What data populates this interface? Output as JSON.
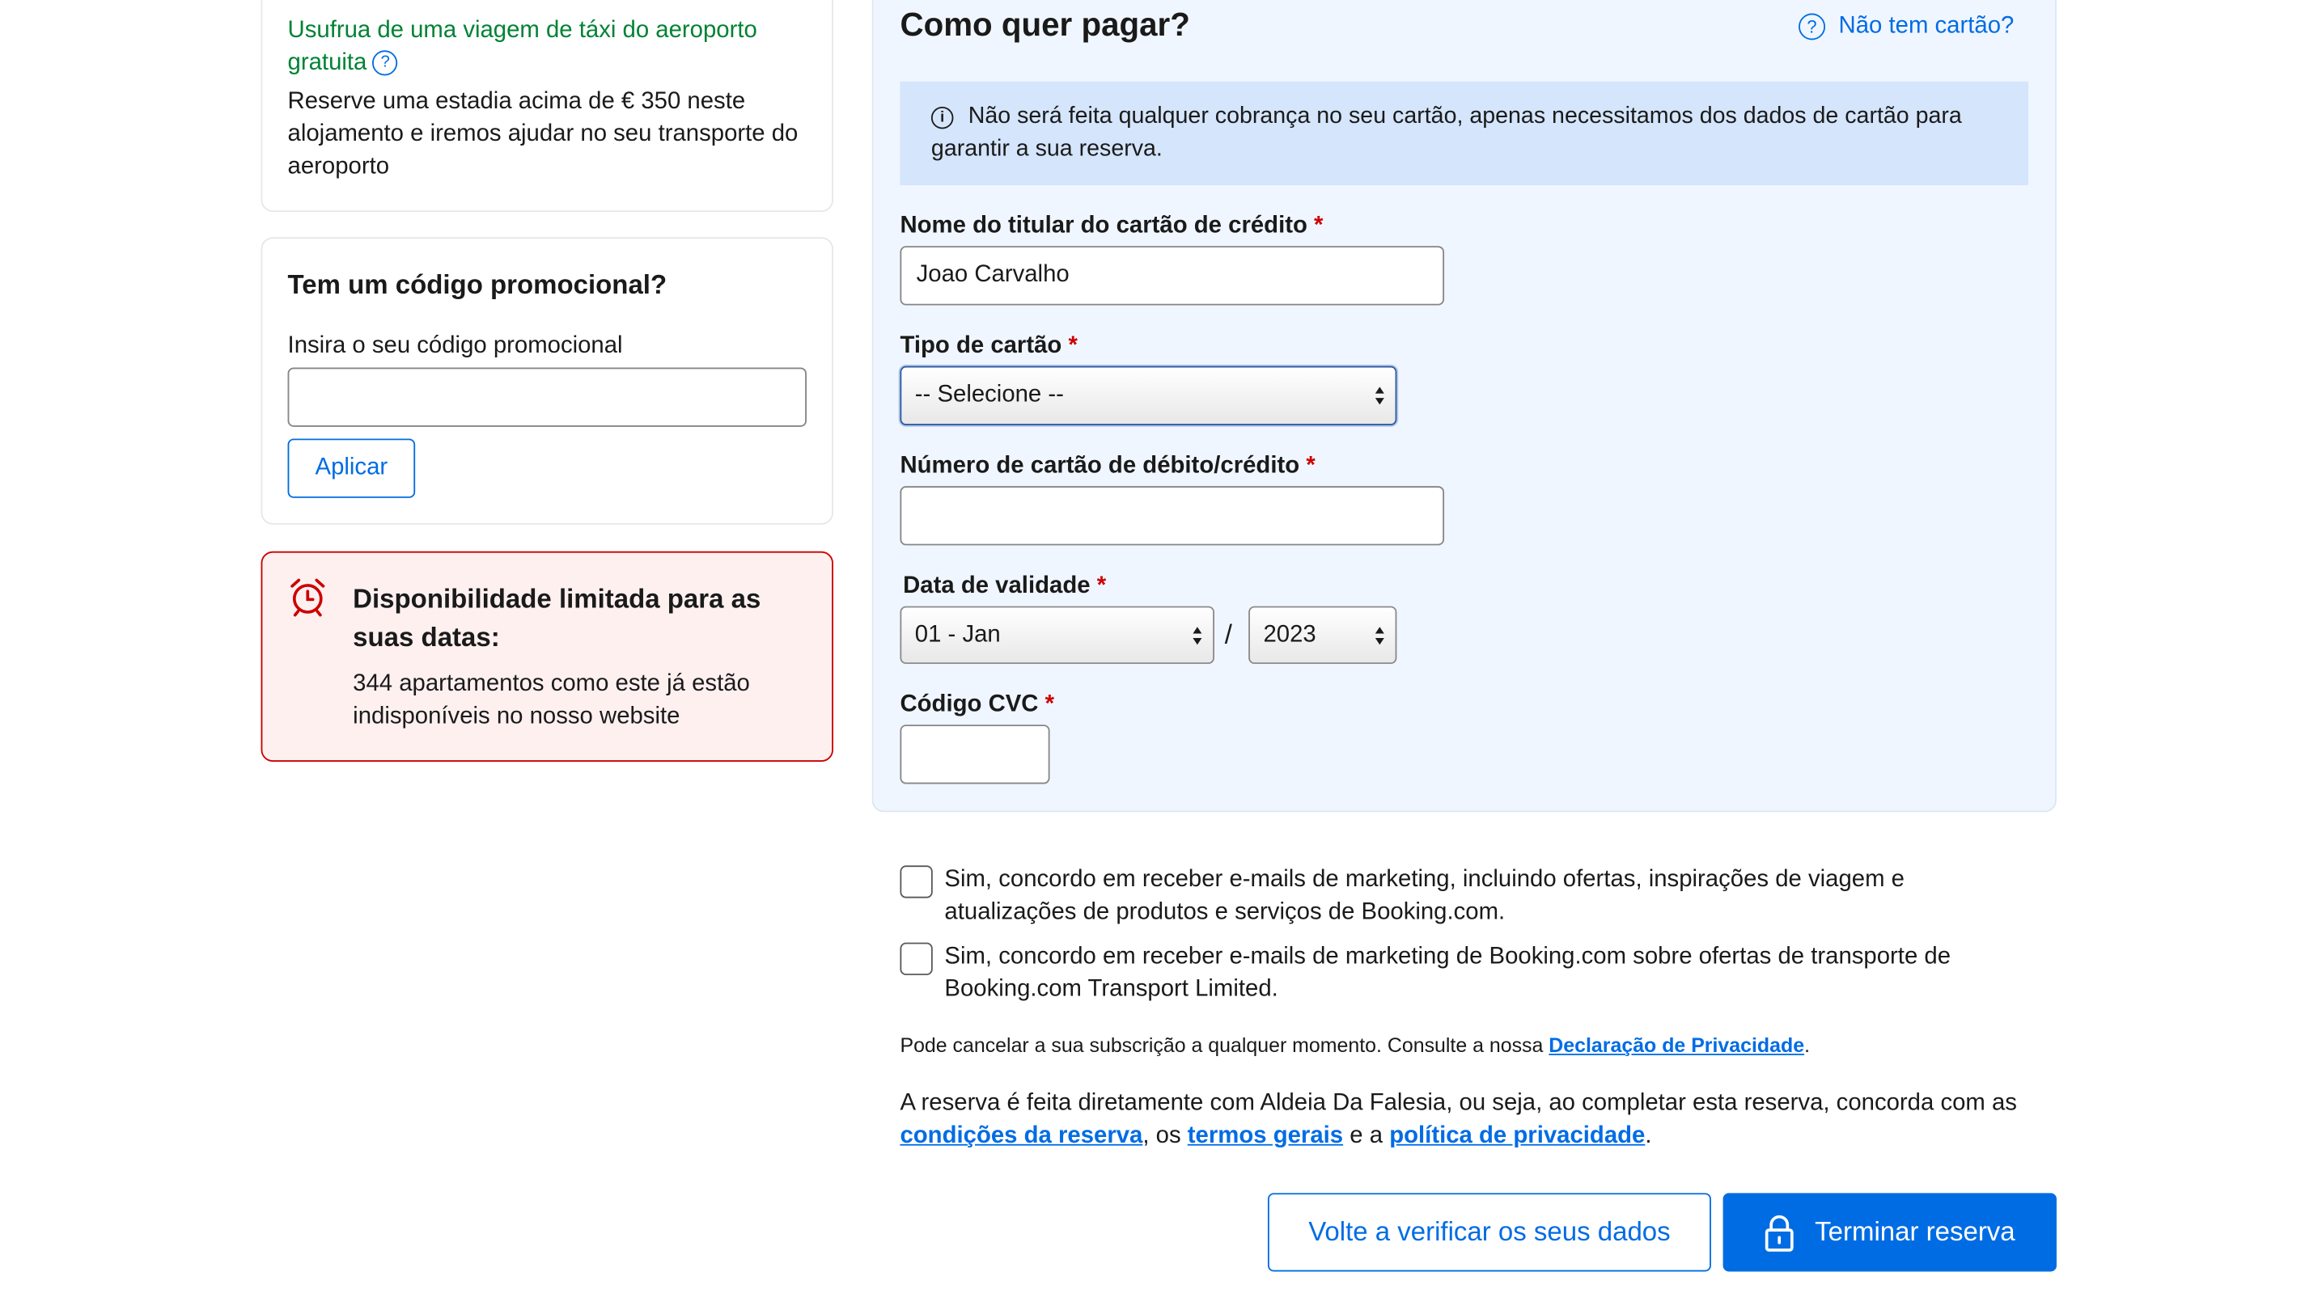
{
  "taxi_card": {
    "title": "Usufrua de uma viagem de táxi do aeroporto gratuita",
    "help_glyph": "?",
    "body": "Reserve uma estadia acima de € 350 neste alojamento e iremos ajudar no seu transporte do aeroporto"
  },
  "promo_card": {
    "heading": "Tem um código promocional?",
    "input_label": "Insira o seu código promocional",
    "input_value": "",
    "apply_label": "Aplicar"
  },
  "availability_alert": {
    "icon": "alarm-clock-icon",
    "heading": "Disponibilidade limitada para as suas datas:",
    "body": "344 apartamentos como este já estão indisponíveis no nosso website"
  },
  "payment": {
    "title": "Como quer pagar?",
    "no_card_link": "Não tem cartão?",
    "help_glyph": "?",
    "info_glyph": "i",
    "info_message": "Não será feita qualquer cobrança no seu cartão, apenas necessitamos dos dados de cartão para garantir a sua reserva.",
    "required_mark": "*",
    "holder_label": "Nome do titular do cartão de crédito",
    "holder_value": "Joao Carvalho",
    "card_type_label": "Tipo de cartão",
    "card_type_value": "-- Selecione --",
    "card_number_label": "Número de cartão de débito/crédito",
    "card_number_value": "",
    "expiry_label": "Data de validade",
    "expiry_month": "01 - Jan",
    "expiry_separator": "/",
    "expiry_year": "2023",
    "cvc_label": "Código CVC",
    "cvc_value": ""
  },
  "consents": {
    "marketing_booking": "Sim, concordo em receber e-mails de marketing, incluindo ofertas, inspirações de viagem e atualizações de produtos e serviços de Booking.com.",
    "marketing_transport": "Sim, concordo em receber e-mails de marketing de Booking.com sobre ofertas de transporte de Booking.com Transport Limited.",
    "unsubscribe_text": "Pode cancelar a sua subscrição a qualquer momento. Consulte a nossa",
    "privacy_statement_link": "Declaração de Privacidade",
    "period": "."
  },
  "terms": {
    "text_before": "A reserva é feita diretamente com Aldeia Da Falesia, ou seja, ao completar esta reserva, concorda com as",
    "conditions_link": "condições da reserva",
    "text_os": ", os",
    "general_terms_link": "termos gerais",
    "text_and": "e a",
    "privacy_policy_link": "política de privacidade",
    "period": "."
  },
  "actions": {
    "review_label": "Volte a verificar os seus dados",
    "complete_label": "Terminar reserva"
  },
  "colors": {
    "brand_blue": "#006ce4",
    "success_green": "#008234",
    "alert_red": "#cc0000",
    "panel_bg": "#f0f6ff",
    "info_bg": "#d4e5fc"
  }
}
